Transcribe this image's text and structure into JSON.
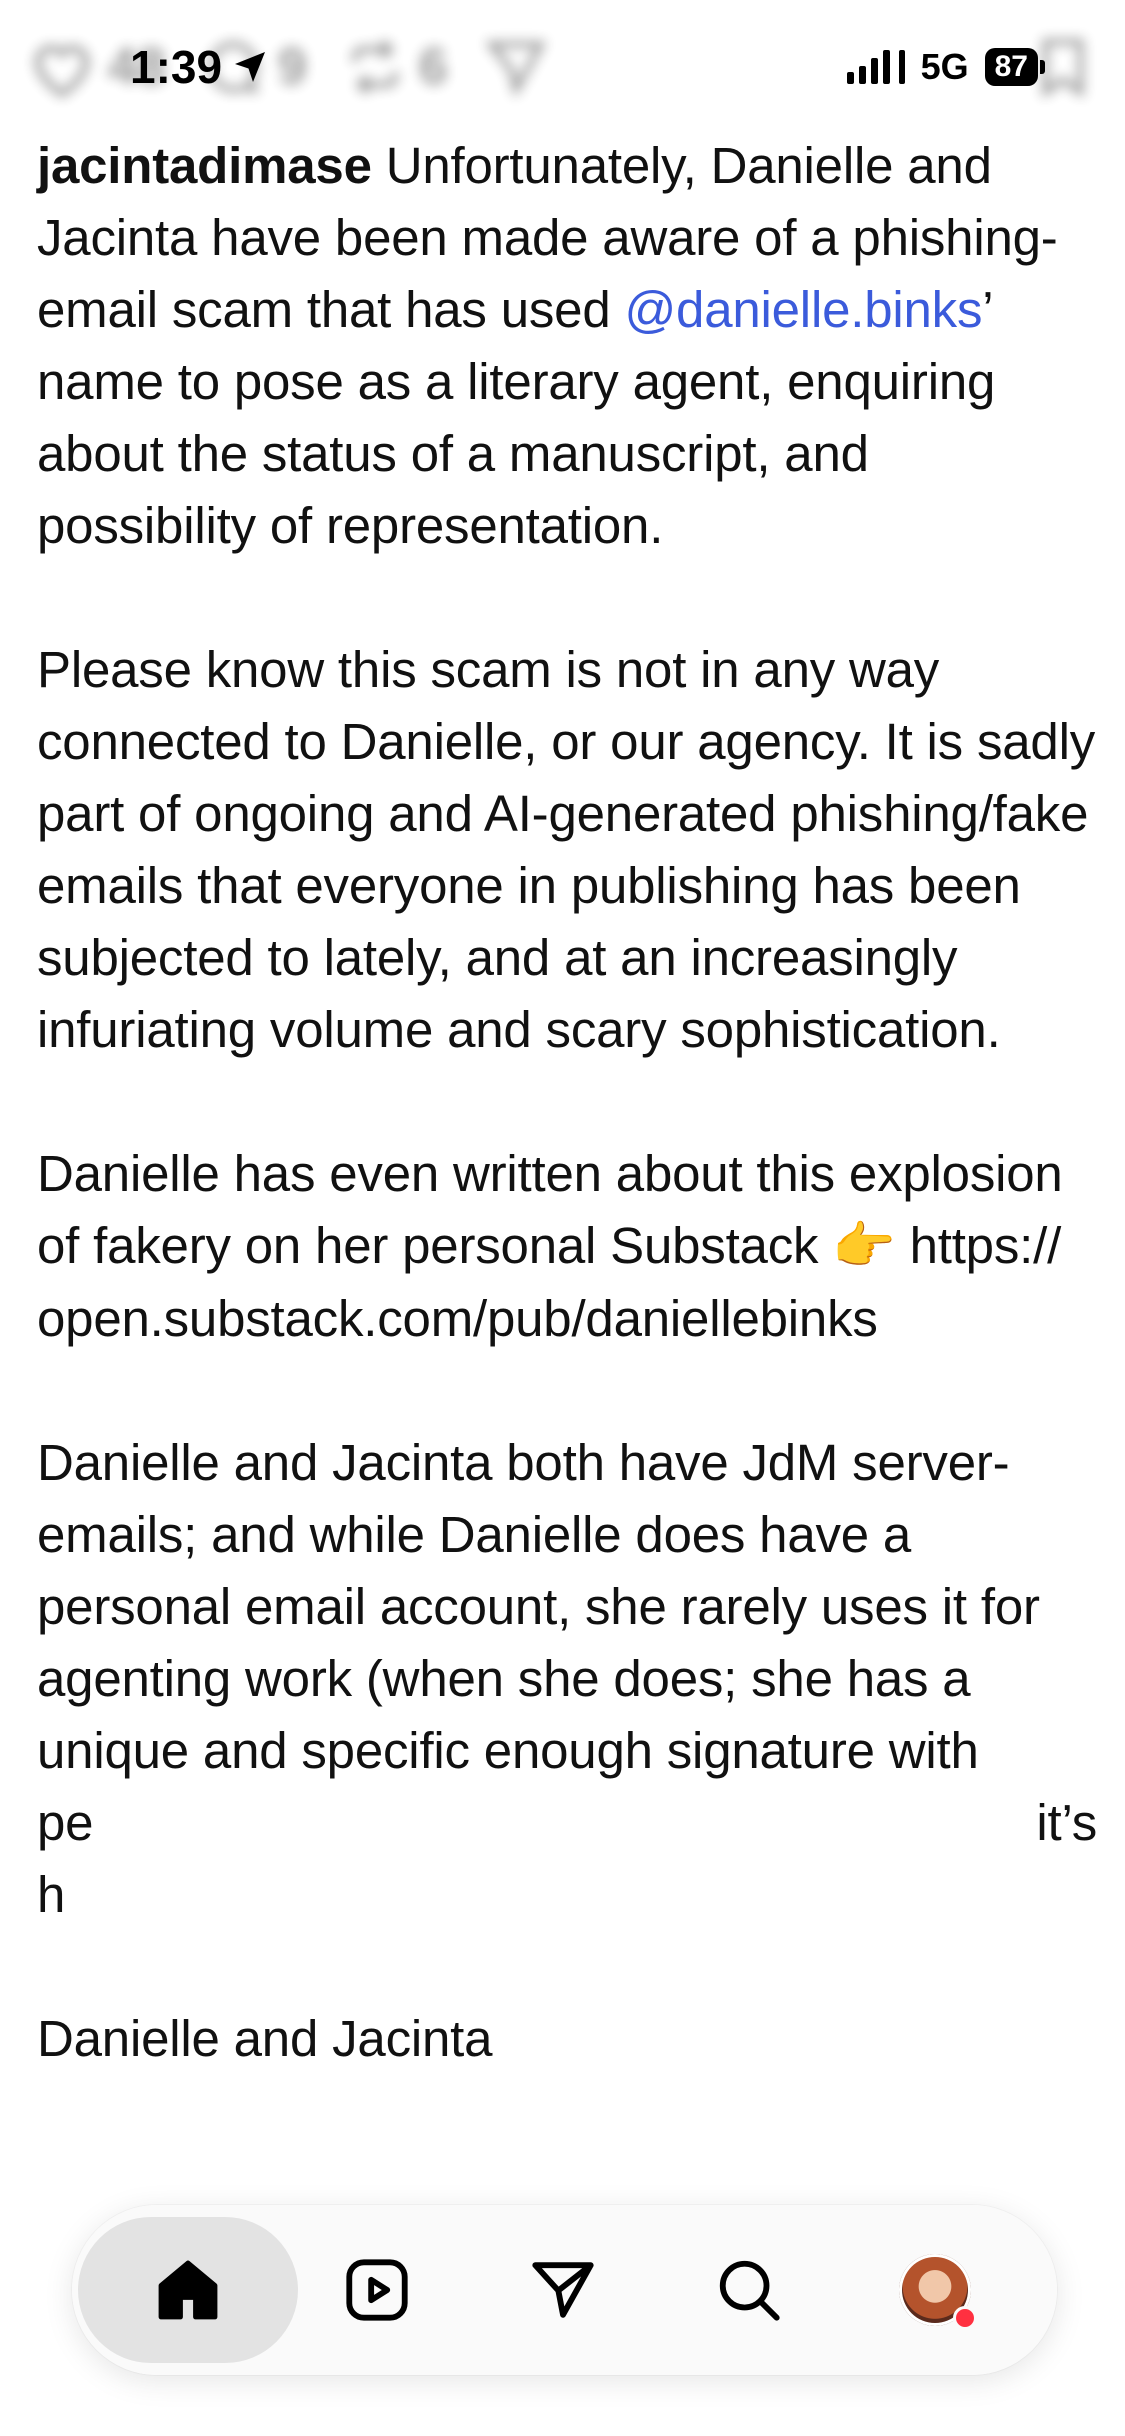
{
  "status_bar": {
    "time": "1:39",
    "network": "5G",
    "battery": "87"
  },
  "background_actions": {
    "likes": "48",
    "comments": "9",
    "reposts": "6"
  },
  "post": {
    "username": "jacintadimase",
    "p1_text_a": " Unfortunately, Danielle and Jacinta have been made aware of a phishing-email scam that has used ",
    "p1_mention": "@danielle.binks",
    "p1_text_b": "’ name to pose as a literary agent, enquiring about the status of a manuscript, and possibility of representation.",
    "p2": "Please know this scam is not in any way connected to Danielle, or our agency. It is sadly part of ongoing and AI-generated phishing/fake emails that everyone in publishing has been subjected to lately, and at an increasingly infuriating volume and scary sophistication.",
    "p3_text_a": "Danielle has even written about this explosion of fakery on her personal Substack ",
    "p3_emoji": "👉",
    "p3_link": " https://\nopen.substack.com/pub/daniellebinks",
    "p4_visible": "Danielle and Jacinta both have JdM server-emails; and while Danielle does have a personal email account, she rarely uses it for agenting work (when she does; she has a unique and specific enough signature with",
    "p4_left_fragment_1": "pe",
    "p4_right_fragment": "it’s",
    "p4_left_fragment_2": "h",
    "p5_fragment": "Danielle and Jacinta"
  },
  "tab_bar": {
    "icons": [
      "home-icon",
      "video-icon",
      "send-icon",
      "search-icon",
      "profile-avatar"
    ],
    "active": "home",
    "accent": "#ff3040"
  },
  "colors": {
    "mention": "#3b5bdb",
    "text": "#111111",
    "background": "#ffffff"
  }
}
